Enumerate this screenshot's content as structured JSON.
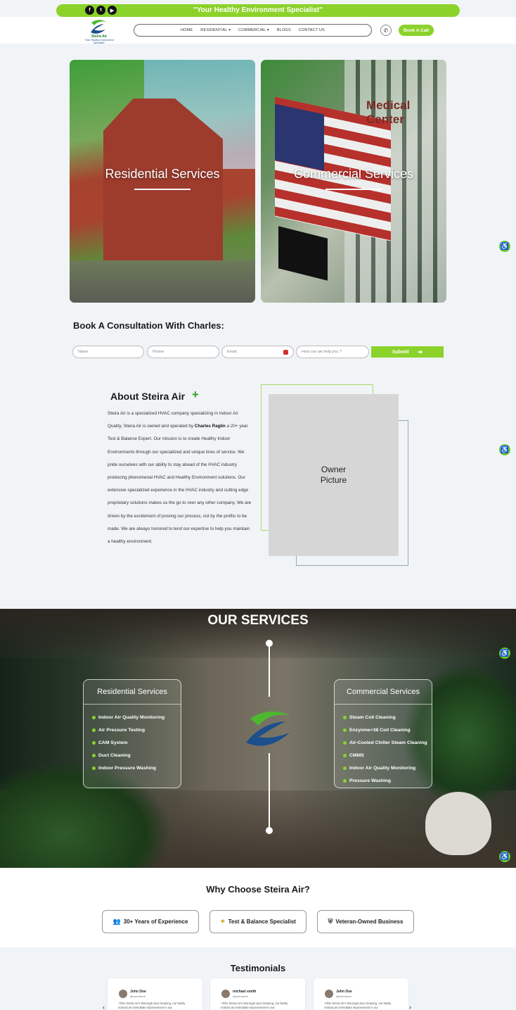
{
  "topbar": {
    "tagline": "\"Your Healthy Environment Specialist\"",
    "socials": [
      "facebook-icon",
      "twitter-icon",
      "youtube-icon"
    ]
  },
  "header": {
    "logo_brand": "Steira Air",
    "logo_tagline": "\"Your Healthy Environment Specialist\"",
    "nav": [
      "HOME",
      "RESIDENTIAL",
      "COMMERCIAL",
      "BLOGS",
      "CONTACT US"
    ],
    "book_call": "Book A Call"
  },
  "cards": {
    "residential": "Residential Services",
    "commercial": "Commercial Services",
    "commercial_sign": "Medical Center"
  },
  "consult": {
    "title": "Book A Consultation With Charles:",
    "name_placeholder": "Name",
    "phone_placeholder": "Phone",
    "email_placeholder": "Email",
    "help_placeholder": "How can we help you ?",
    "submit": "Submit"
  },
  "about": {
    "title": "About Steira Air",
    "plus": "+",
    "text_1": "Steira Air is a specialized HVAC company specializing in Indoor Air Quality. Steira Air is owned and operated by ",
    "owner_name": "Charles Raglin",
    "text_2": " a 20+ year Test & Balance Expert. Our mission is to create Healthy Indoor Environments through our specialized and unique lines of service. We pride ourselves with our ability to stay ahead of the HVAC industry producing phenomenal HVAC and Healthy Environment solutions. Our extensive specialized experience in the HVAC industry and cutting edge proprietary solutions makes us the go to over any other company. We are driven by the excitement of proving our process, not by the profits to be made. We are always honored to lend our expertise to help you maintain a healthy environment.",
    "owner_picture": "Owner\nPicture"
  },
  "services": {
    "title": "OUR SERVICES",
    "residential_title": "Residential Services",
    "residential_items": [
      "Indoor Air Quality Monitoring",
      "Air Pressure Testing",
      "CAM System",
      "Duct Cleaning",
      "Indoor Pressure Washing"
    ],
    "commercial_title": "Commercial Services",
    "commercial_items": [
      "Steam Coil Cleaning",
      "Enzynme+38 Coil Cleaning",
      "Air-Cooled Chiller Steam Cleaning",
      "CMMS",
      "Indoor Air Quality Monitoring",
      "Pressure Washing"
    ]
  },
  "why": {
    "title": "Why Choose Steira Air?",
    "items": [
      "30+ Years of Experience",
      "Test & Balance Specialist",
      "Veteran-Owned Business"
    ]
  },
  "testimonials": {
    "title": "Testimonials",
    "cards": [
      {
        "name": "John Doe",
        "handle": "@username",
        "quote": "\"After Steira Air's thorough duct cleaning, our family noticed an immediate improvement in our"
      },
      {
        "name": "michael smith",
        "handle": "@username",
        "quote": "\"After Steira Air's thorough duct cleaning, our family noticed an immediate improvement in our"
      },
      {
        "name": "John Doe",
        "handle": "@username",
        "quote": "\"After Steira Air's thorough duct cleaning, our family noticed an immediate improvement in our"
      }
    ],
    "prev": "‹",
    "next": "›"
  },
  "colors": {
    "accent": "#8bd22a",
    "brand_blue": "#1c4f8c",
    "brand_green": "#1a7a2e"
  }
}
